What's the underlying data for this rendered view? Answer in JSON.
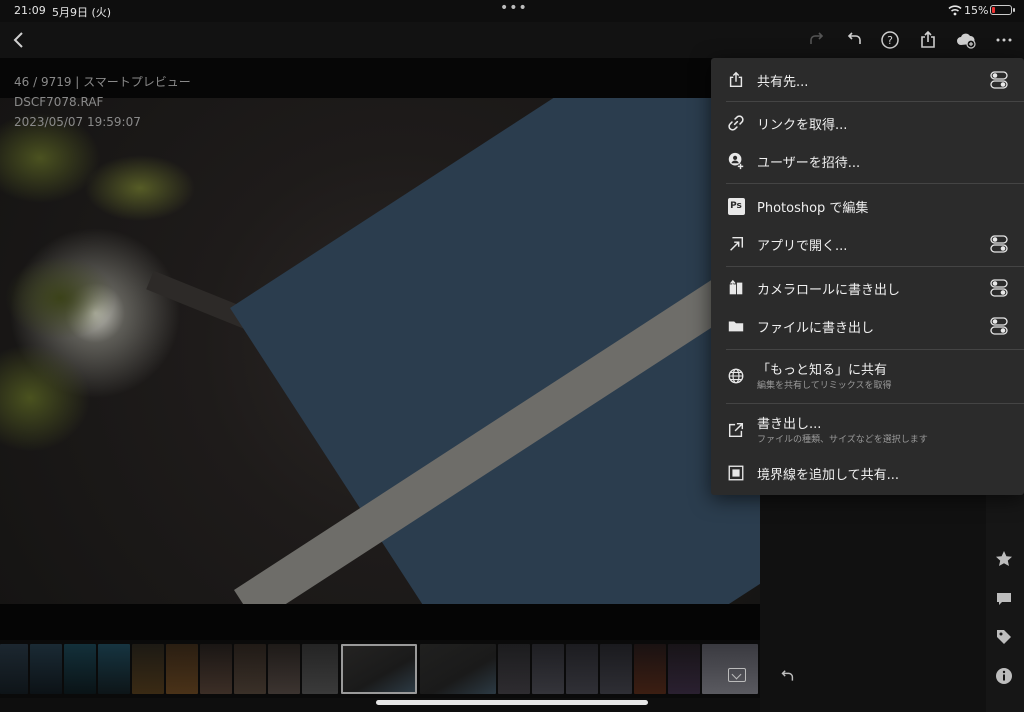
{
  "status_bar": {
    "time": "21:09",
    "date": "5月9日 (火)",
    "multitask_dots": "•••",
    "battery_percent": "15%",
    "battery_level": 0.15,
    "battery_color": "#e33333"
  },
  "toolbar": {
    "icons": [
      "back-icon",
      "redo-icon",
      "undo-icon",
      "help-icon",
      "share-icon",
      "cloud-add-icon",
      "more-icon"
    ]
  },
  "photo_info": {
    "counter": "46 / 9719 | スマートプレビュー",
    "filename": "DSCF7078.RAF",
    "datetime": "2023/05/07 19:59:07"
  },
  "share_menu": {
    "items": [
      {
        "label": "共有先...",
        "icon": "share-to-icon",
        "has_toggle": true
      },
      {
        "label": "リンクを取得...",
        "icon": "link-icon",
        "has_toggle": false
      },
      {
        "label": "ユーザーを招待...",
        "icon": "invite-user-icon",
        "has_toggle": false
      },
      {
        "label": "Photoshop で編集",
        "icon": "photoshop-icon",
        "badge": "Ps",
        "has_toggle": false
      },
      {
        "label": "アプリで開く...",
        "icon": "open-in-app-icon",
        "has_toggle": true
      },
      {
        "label": "カメラロールに書き出し",
        "icon": "camera-roll-icon",
        "has_toggle": true
      },
      {
        "label": "ファイルに書き出し",
        "icon": "folder-icon",
        "has_toggle": true
      },
      {
        "label": "「もっと知る」に共有",
        "sub": "編集を共有してリミックスを取得",
        "icon": "globe-icon",
        "has_toggle": false
      },
      {
        "label": "書き出し...",
        "sub": "ファイルの種類、サイズなどを選択します",
        "icon": "export-icon",
        "has_toggle": false
      },
      {
        "label": "境界線を追加して共有...",
        "icon": "border-icon",
        "has_toggle": false
      }
    ]
  },
  "side_panel": {
    "icons": [
      "star-icon",
      "comment-icon",
      "tag-icon",
      "info-icon"
    ]
  },
  "colors": {
    "menu_bg": "#2b2b2b",
    "app_bg": "#0e0e0e",
    "text": "#efefef"
  }
}
